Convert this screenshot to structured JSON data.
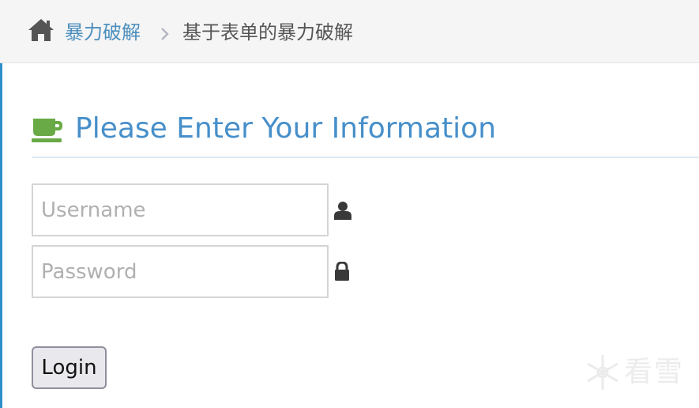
{
  "breadcrumb": {
    "home_icon": "home-icon",
    "parent_label": "暴力破解",
    "separator_icon": "chevron-right-icon",
    "current_label": "基于表单的暴力破解"
  },
  "header": {
    "icon": "coffee-cup-icon",
    "title": "Please Enter Your Information"
  },
  "form": {
    "username_placeholder": "Username",
    "username_value": "",
    "username_icon": "user-icon",
    "password_placeholder": "Password",
    "password_value": "",
    "password_icon": "lock-icon",
    "login_label": "Login"
  },
  "watermark": {
    "text": "看雪",
    "icon": "snowflake-icon"
  },
  "colors": {
    "link": "#4c8fbd",
    "title": "#478fca",
    "cup_icon": "#69aa46",
    "sidebar_accent": "#2c8fc9",
    "breadcrumb_bg": "#f5f5f5"
  }
}
